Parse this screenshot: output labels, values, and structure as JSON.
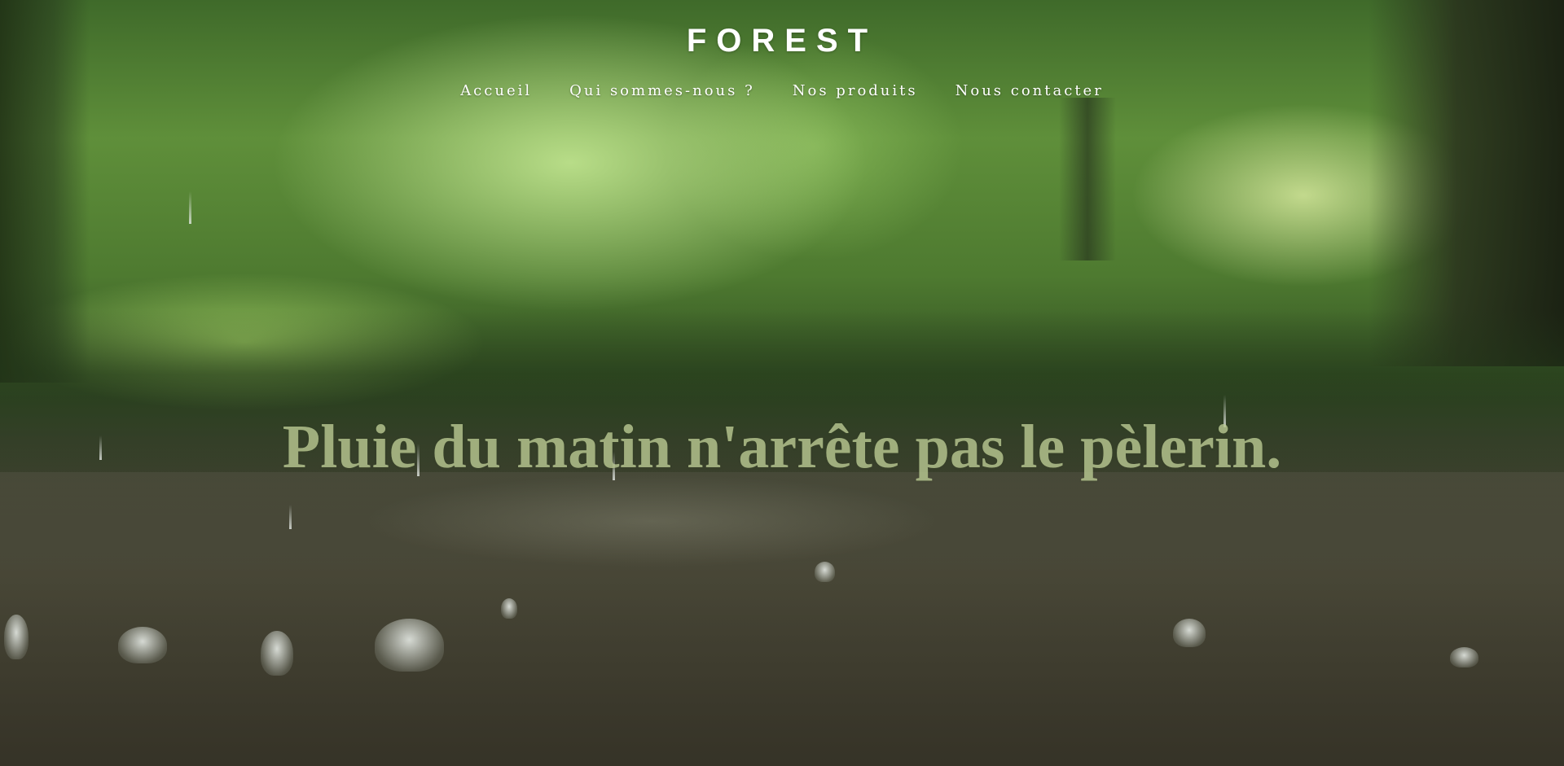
{
  "brand": {
    "title": "FOREST"
  },
  "nav": {
    "items": [
      {
        "label": "Accueil"
      },
      {
        "label": "Qui sommes-nous ?"
      },
      {
        "label": "Nos produits"
      },
      {
        "label": "Nous contacter"
      }
    ]
  },
  "hero": {
    "tagline": "Pluie du matin n'arrête pas le pèlerin.",
    "background": "rainy-forest-photo"
  },
  "colors": {
    "text": "#ffffff",
    "tagline": "#becd96"
  }
}
